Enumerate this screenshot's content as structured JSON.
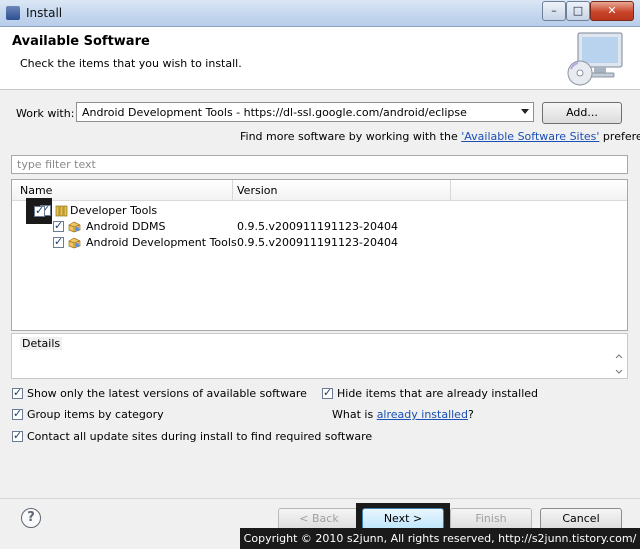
{
  "window": {
    "title": "Install"
  },
  "header": {
    "title": "Available Software",
    "description": "Check the items that you wish to install."
  },
  "work_with": {
    "label": "Work with:",
    "value": "Android Development Tools - https://dl-ssl.google.com/android/eclipse",
    "add_button": "Add..."
  },
  "find_more": {
    "prefix": "Find more software by working with the ",
    "link": "'Available Software Sites'",
    "suffix": " preferences."
  },
  "filter": {
    "placeholder": "type filter text"
  },
  "tree": {
    "columns": [
      "Name",
      "Version"
    ],
    "rows": [
      {
        "name": "Developer Tools",
        "version": "",
        "checked": true,
        "level": 0
      },
      {
        "name": "Android DDMS",
        "version": "0.9.5.v200911191123-20404",
        "checked": true,
        "level": 1
      },
      {
        "name": "Android Development Tools",
        "version": "0.9.5.v200911191123-20404",
        "checked": true,
        "level": 1
      }
    ]
  },
  "details": {
    "label": "Details"
  },
  "options": {
    "show_latest": "Show only the latest versions of available software",
    "hide_installed": "Hide items that are already installed",
    "group_by_category": "Group items by category",
    "what_is_prefix": "What is ",
    "what_is_link": "already installed",
    "what_is_suffix": "?",
    "contact_sites": "Contact all update sites during install to find required software"
  },
  "buttons": {
    "back": "< Back",
    "next": "Next >",
    "finish": "Finish",
    "cancel": "Cancel"
  },
  "watermark": "Copyright © 2010 s2junn, All rights reserved, http://s2junn.tistory.com/"
}
